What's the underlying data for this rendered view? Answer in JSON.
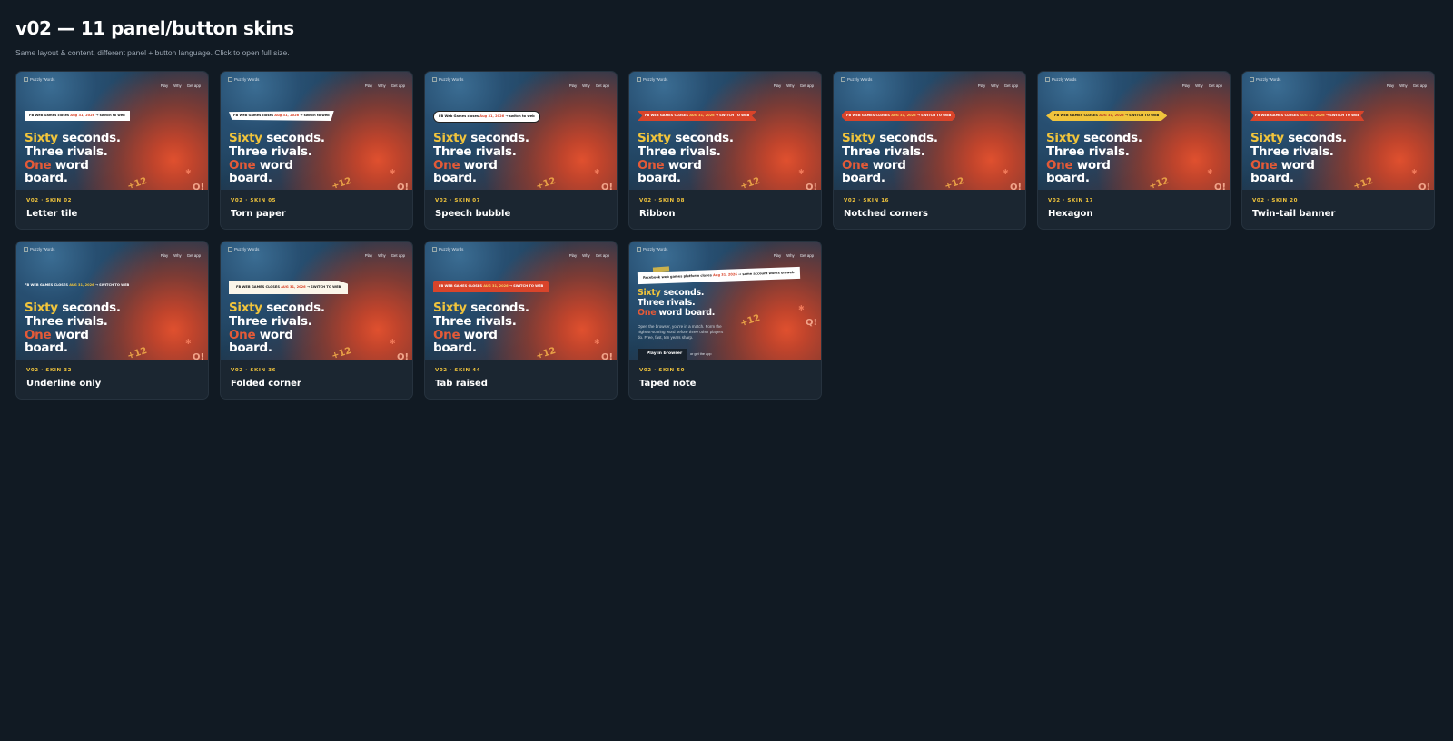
{
  "header": {
    "title": "v02 — 11 panel/button skins",
    "subtitle": "Same layout & content, different panel + button language. Click to open full size."
  },
  "preview": {
    "logo_alt": "Puzzly Words",
    "nav": [
      "Play",
      "Why",
      "Get app"
    ],
    "banner_lower": {
      "pre": "FB Web Games closes ",
      "date": "Aug 31, 2026",
      "post": " → switch to web"
    },
    "banner_upper": {
      "pre": "FB WEB GAMES CLOSES ",
      "date": "AUG 31, 2026",
      "post": " → SWITCH TO WEB"
    },
    "banner_taped": {
      "pre": "Facebook web games platform closes ",
      "date": "Aug 31, 2026",
      "post": " → same account works on web"
    },
    "headline": {
      "w1": "Sixty",
      "w2": " seconds.",
      "w3": "Three rivals.",
      "w4": "One",
      "w5": " word",
      "w6": "board."
    },
    "plus": "+12",
    "q": "Q!",
    "star": "✱",
    "body": "Open the browser, you're in a match. Form the highest-scoring word before three other players do. Free, fast, ten years sharp.",
    "cta": "Play in browser",
    "cta_alt": "or get the app"
  },
  "cards": [
    {
      "code": "V02 · SKIN 02",
      "name": "Letter tile"
    },
    {
      "code": "V02 · SKIN 05",
      "name": "Torn paper"
    },
    {
      "code": "V02 · SKIN 07",
      "name": "Speech bubble"
    },
    {
      "code": "V02 · SKIN 08",
      "name": "Ribbon"
    },
    {
      "code": "V02 · SKIN 16",
      "name": "Notched corners"
    },
    {
      "code": "V02 · SKIN 17",
      "name": "Hexagon"
    },
    {
      "code": "V02 · SKIN 20",
      "name": "Twin-tail banner"
    },
    {
      "code": "V02 · SKIN 32",
      "name": "Underline only"
    },
    {
      "code": "V02 · SKIN 36",
      "name": "Folded corner"
    },
    {
      "code": "V02 · SKIN 44",
      "name": "Tab raised"
    },
    {
      "code": "V02 · SKIN 50",
      "name": "Taped note"
    }
  ],
  "colors": {
    "background": "#111a23",
    "card": "#1b2631",
    "accent_yellow": "#f0c43c",
    "accent_orange": "#e35a38"
  }
}
